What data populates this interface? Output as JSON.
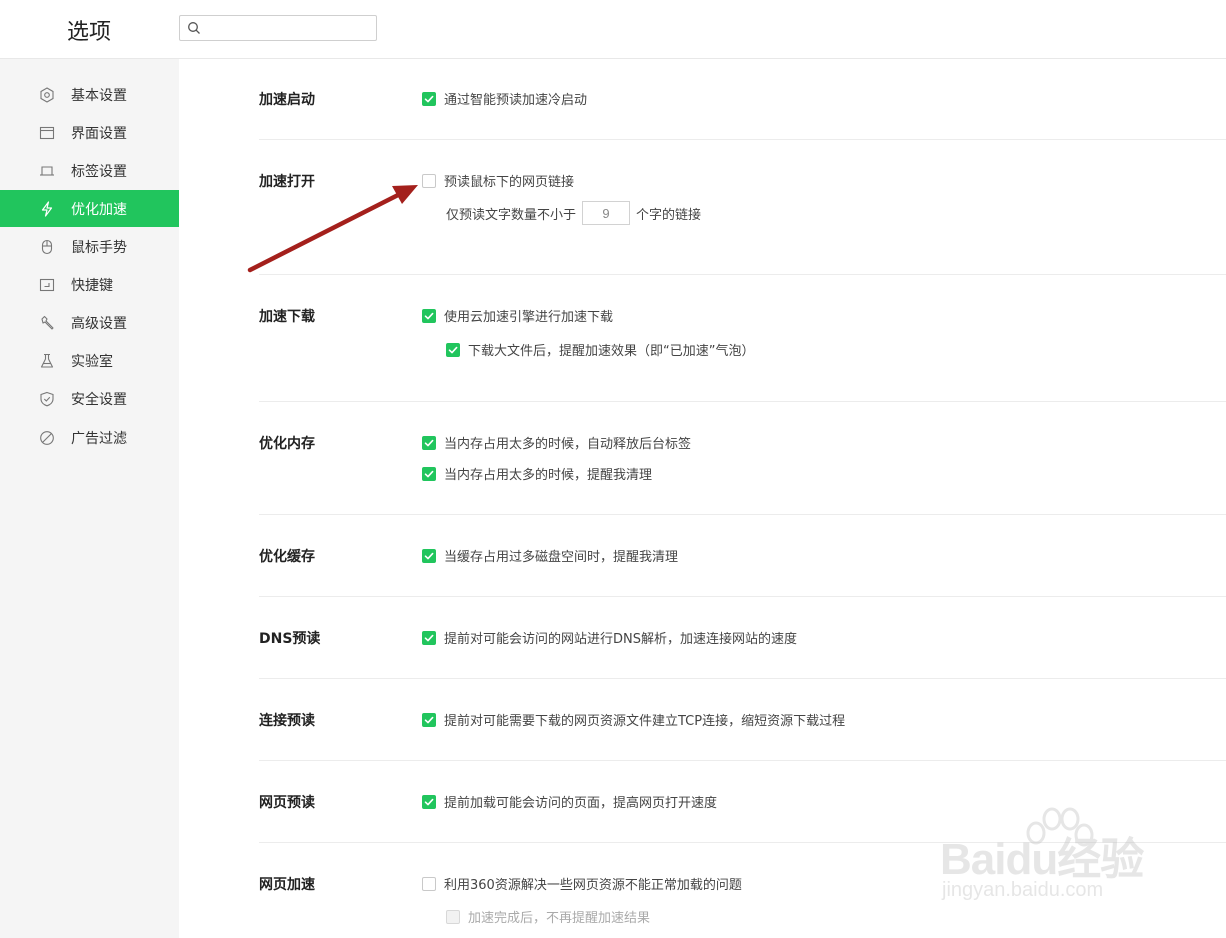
{
  "header": {
    "title": "选项",
    "search": {
      "placeholder": "",
      "value": ""
    }
  },
  "sidebar": {
    "items": [
      {
        "label": "基本设置",
        "icon": "gear-icon",
        "active": false
      },
      {
        "label": "界面设置",
        "icon": "window-icon",
        "active": false
      },
      {
        "label": "标签设置",
        "icon": "tab-icon",
        "active": false
      },
      {
        "label": "优化加速",
        "icon": "lightning-icon",
        "active": true
      },
      {
        "label": "鼠标手势",
        "icon": "mouse-icon",
        "active": false
      },
      {
        "label": "快捷键",
        "icon": "keyboard-icon",
        "active": false
      },
      {
        "label": "高级设置",
        "icon": "wrench-icon",
        "active": false
      },
      {
        "label": "实验室",
        "icon": "flask-icon",
        "active": false
      },
      {
        "label": "安全设置",
        "icon": "shield-icon",
        "active": false
      },
      {
        "label": "广告过滤",
        "icon": "block-icon",
        "active": false
      }
    ]
  },
  "sections": {
    "startup": {
      "title": "加速启动",
      "options": [
        {
          "label": "通过智能预读加速冷启动",
          "checked": true
        }
      ]
    },
    "open": {
      "title": "加速打开",
      "options": [
        {
          "label": "预读鼠标下的网页链接",
          "checked": false
        }
      ],
      "threshold": {
        "prefix": "仅预读文字数量不小于",
        "value": "9",
        "suffix": "个字的链接"
      }
    },
    "download": {
      "title": "加速下载",
      "options": [
        {
          "label": "使用云加速引擎进行加速下载",
          "checked": true
        },
        {
          "label": "下载大文件后，提醒加速效果（即“已加速”气泡）",
          "checked": true
        }
      ]
    },
    "memory": {
      "title": "优化内存",
      "options": [
        {
          "label": "当内存占用太多的时候，自动释放后台标签",
          "checked": true
        },
        {
          "label": "当内存占用太多的时候，提醒我清理",
          "checked": true
        }
      ]
    },
    "cache": {
      "title": "优化缓存",
      "options": [
        {
          "label": "当缓存占用过多磁盘空间时，提醒我清理",
          "checked": true
        }
      ]
    },
    "dns": {
      "title": "DNS预读",
      "options": [
        {
          "label": "提前对可能会访问的网站进行DNS解析，加速连接网站的速度",
          "checked": true
        }
      ]
    },
    "connect": {
      "title": "连接预读",
      "options": [
        {
          "label": "提前对可能需要下载的网页资源文件建立TCP连接，缩短资源下载过程",
          "checked": true
        }
      ]
    },
    "pageprefetch": {
      "title": "网页预读",
      "options": [
        {
          "label": "提前加载可能会访问的页面，提高网页打开速度",
          "checked": true
        }
      ]
    },
    "pageaccel": {
      "title": "网页加速",
      "options": [
        {
          "label": "利用360资源解决一些网页资源不能正常加载的问题",
          "checked": false
        },
        {
          "label": "加速完成后，不再提醒加速结果",
          "checked": false,
          "disabled": true
        }
      ]
    }
  },
  "watermark": {
    "brand": "Baidu经验",
    "url": "jingyan.baidu.com"
  },
  "colors": {
    "accent": "#21c55d",
    "arrow": "#a4201c",
    "sidebar_bg": "#f5f5f5"
  }
}
